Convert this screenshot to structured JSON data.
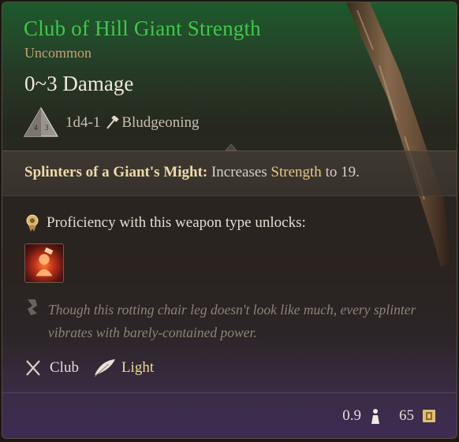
{
  "item": {
    "name": "Club of Hill Giant Strength",
    "rarity": "Uncommon",
    "damage_range": "0~3 Damage",
    "damage_dice": "1d4-1",
    "damage_type": "Bludgeoning",
    "passive_name": "Splinters of a Giant's Might:",
    "passive_text_pre": "Increases",
    "passive_stat": "Strength",
    "passive_text_post": "to 19.",
    "proficiency_label": "Proficiency with this weapon type unlocks:",
    "lore": "Though this rotting chair leg doesn't look like much, every splinter vibrates with barely-contained power.",
    "weapon_type": "Club",
    "property": "Light",
    "weight": "0.9",
    "value": "65"
  },
  "icons": {
    "die": "d4-die-icon",
    "damage_type": "hammer-icon",
    "proficiency": "proficiency-badge-icon",
    "action": "action-fire-icon",
    "lore": "quill-icon",
    "weapon_type": "crossed-clubs-icon",
    "property": "feather-icon",
    "weight": "weight-icon",
    "value": "gold-coin-icon"
  },
  "colors": {
    "name": "#3ec84a",
    "rarity": "#c7a071",
    "passive_name": "#eedbaa",
    "highlight": "#e6c782"
  }
}
